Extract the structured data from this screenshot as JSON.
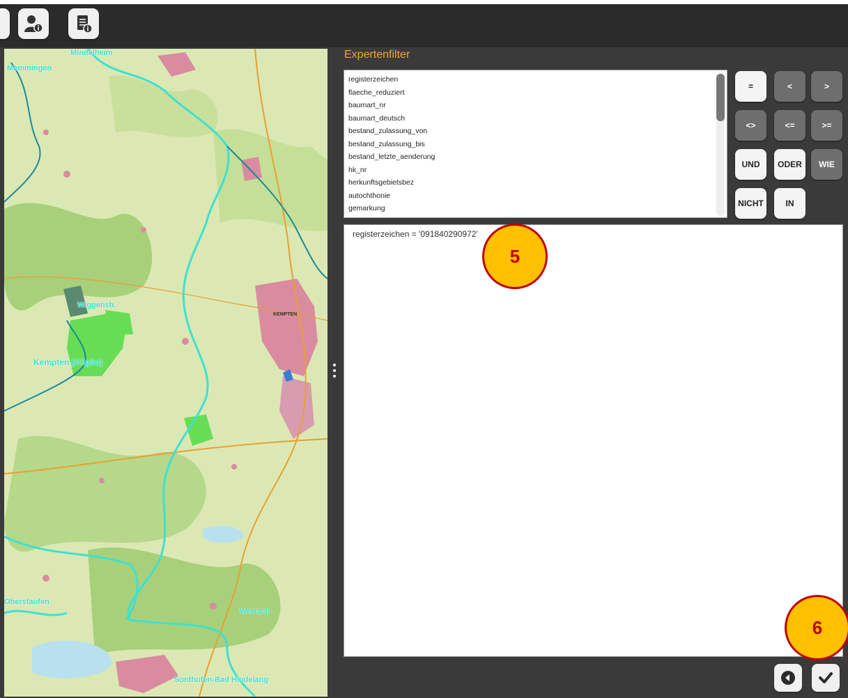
{
  "toolbar": {
    "icons": [
      "user-info-icon",
      "document-info-icon"
    ]
  },
  "map": {
    "labels": [
      {
        "name": "mindelheim",
        "text": "Mindelheim"
      },
      {
        "name": "memmingen",
        "text": "Memmingen"
      },
      {
        "name": "kempten-allgaeu",
        "text": "Kempten (Allgäu)"
      },
      {
        "name": "wiggensbach",
        "text": "Wiggensb."
      },
      {
        "name": "oberstaufen",
        "text": "Oberstaufen"
      },
      {
        "name": "wertach",
        "text": "Wertach"
      },
      {
        "name": "bad-hindelang",
        "text": "Sonthofen-Bad Hindelang"
      },
      {
        "name": "town-kempten",
        "text": "KEMPTEN"
      }
    ]
  },
  "filter": {
    "title": "Expertenfilter",
    "fields": [
      "registerzeichen",
      "flaeche_reduziert",
      "baumart_nr",
      "baumart_deutsch",
      "bestand_zulassung_von",
      "bestand_zulassung_bis",
      "bestand_letzte_aenderung",
      "hk_nr",
      "herkunftsgebietsbez",
      "autochthonie",
      "gemarkung"
    ],
    "operators": {
      "eq": "=",
      "lt": "<",
      "gt": ">",
      "ne": "<>",
      "le": "<=",
      "ge": ">=",
      "und": "UND",
      "oder": "ODER",
      "wie": "WIE",
      "nicht": "NICHT",
      "in": "IN"
    },
    "expression": "registerzeichen = '091840290972'"
  },
  "badges": {
    "step5": "5",
    "step6": "6"
  },
  "colors": {
    "accent": "#f0a830",
    "badge_fill": "#ffc000",
    "badge_border": "#c00000",
    "boundary": "#3fe0d0"
  }
}
